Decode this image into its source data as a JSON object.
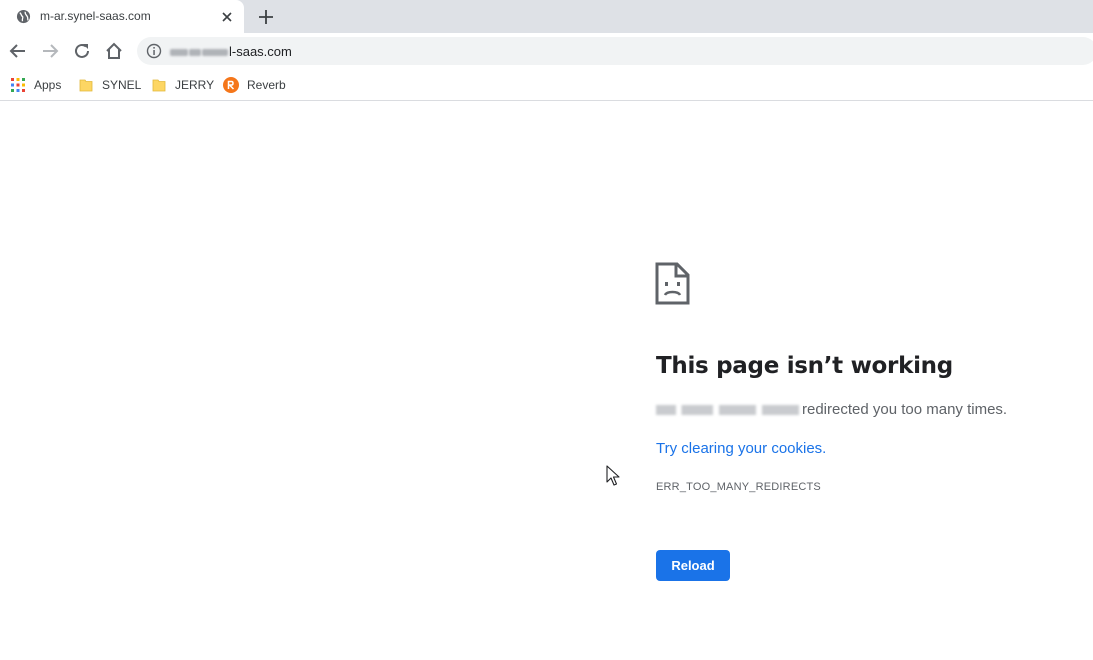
{
  "tab": {
    "title": "m-ar.synel-saas.com",
    "favicon": "globe-icon",
    "close_icon": "close-icon",
    "new_tab_icon": "plus-icon"
  },
  "toolbar": {
    "back_icon": "back-arrow-icon",
    "forward_icon": "forward-arrow-icon",
    "reload_icon": "reload-icon",
    "home_icon": "home-icon",
    "site_info_icon": "info-icon",
    "url_visible": "l-saas.com"
  },
  "bookmarks": [
    {
      "label": "Apps",
      "icon": "apps-grid-icon"
    },
    {
      "label": "SYNEL",
      "icon": "folder-icon"
    },
    {
      "label": "JERRY",
      "icon": "folder-icon"
    },
    {
      "label": "Reverb",
      "icon": "reverb-icon"
    }
  ],
  "error": {
    "icon": "sad-page-icon",
    "title": "This page isn’t working",
    "description": "redirected you too many times.",
    "suggestion_link": "Try clearing your cookies.",
    "code": "ERR_TOO_MANY_REDIRECTS",
    "reload_label": "Reload"
  },
  "colors": {
    "accent": "#1a73e8",
    "tabstrip": "#dee1e6",
    "omnibox": "#f1f3f4",
    "text_secondary": "#5f6368",
    "folder": "#fdd663",
    "reverb": "#f5761a"
  }
}
